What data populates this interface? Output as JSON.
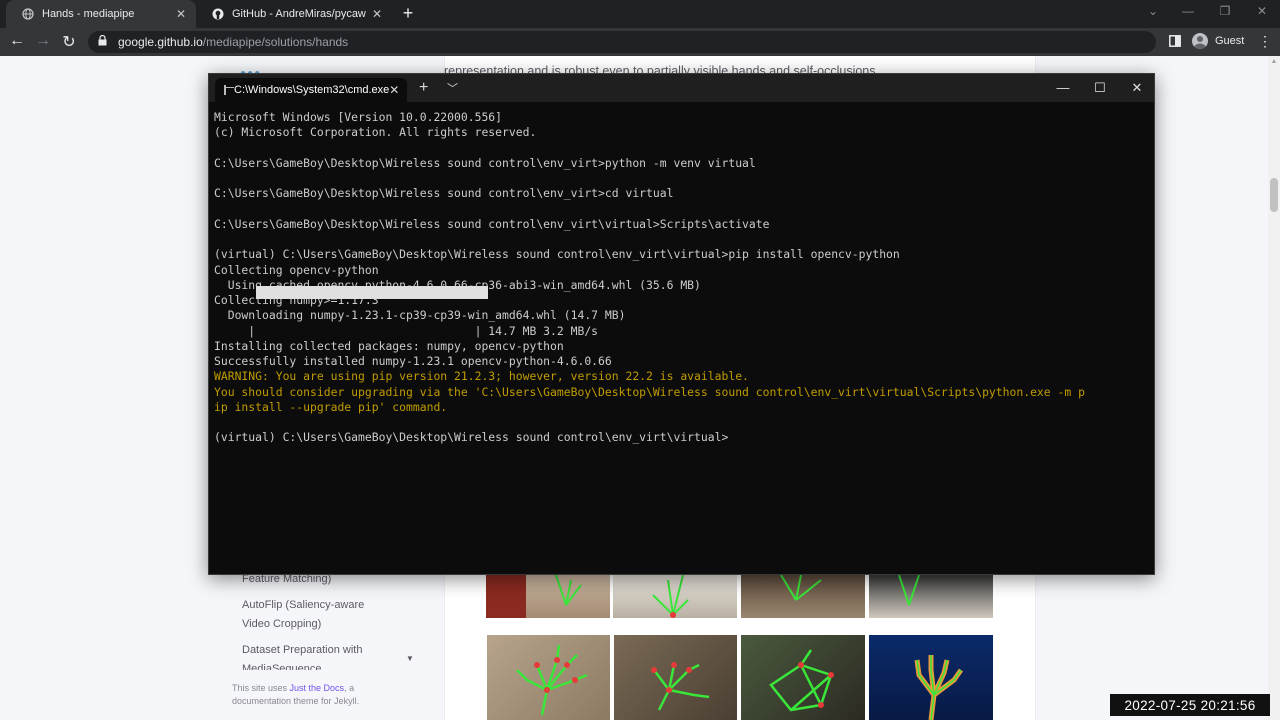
{
  "browser": {
    "tabs": [
      {
        "title": "Hands - mediapipe",
        "active": true
      },
      {
        "title": "GitHub - AndreMiras/pycaw: Pyth",
        "active": false
      }
    ],
    "new_tab_label": "+",
    "address_host": "google.github.io",
    "address_path": "/mediapipe/solutions/hands",
    "profile_label": "Guest"
  },
  "page": {
    "top_text": "representation and is robust even to partially visible hands and self-occlusions.",
    "sidebar_items": [
      "Feature Matching)",
      "AutoFlip (Saliency-aware",
      "Video Cropping)",
      "Dataset Preparation with",
      "MediaSequence"
    ],
    "footer_prefix": "This site uses ",
    "footer_link": "Just the Docs",
    "footer_mid": ", a",
    "footer_line2": "documentation theme for Jekyll."
  },
  "terminal": {
    "tab_title": "C:\\Windows\\System32\\cmd.exe",
    "lines": [
      {
        "text": "Microsoft Windows [Version 10.0.22000.556]",
        "style": "normal"
      },
      {
        "text": "(c) Microsoft Corporation. All rights reserved.",
        "style": "normal"
      },
      {
        "text": "",
        "style": "normal"
      },
      {
        "text": "C:\\Users\\GameBoy\\Desktop\\Wireless sound control\\env_virt>python -m venv virtual",
        "style": "normal"
      },
      {
        "text": "",
        "style": "normal"
      },
      {
        "text": "C:\\Users\\GameBoy\\Desktop\\Wireless sound control\\env_virt>cd virtual",
        "style": "normal"
      },
      {
        "text": "",
        "style": "normal"
      },
      {
        "text": "C:\\Users\\GameBoy\\Desktop\\Wireless sound control\\env_virt\\virtual>Scripts\\activate",
        "style": "normal"
      },
      {
        "text": "",
        "style": "normal"
      },
      {
        "text": "(virtual) C:\\Users\\GameBoy\\Desktop\\Wireless sound control\\env_virt\\virtual>pip install opencv-python",
        "style": "normal"
      },
      {
        "text": "Collecting opencv-python",
        "style": "normal"
      },
      {
        "text": "  Using cached opencv_python-4.6.0.66-cp36-abi3-win_amd64.whl (35.6 MB)",
        "style": "normal"
      },
      {
        "text": "Collecting numpy>=1.17.3",
        "style": "normal"
      },
      {
        "text": "  Downloading numpy-1.23.1-cp39-cp39-win_amd64.whl (14.7 MB)",
        "style": "normal"
      },
      {
        "text": "     |                                | 14.7 MB 3.2 MB/s",
        "style": "normal"
      },
      {
        "text": "Installing collected packages: numpy, opencv-python",
        "style": "normal"
      },
      {
        "text": "Successfully installed numpy-1.23.1 opencv-python-4.6.0.66",
        "style": "normal"
      },
      {
        "text": "WARNING: You are using pip version 21.2.3; however, version 22.2 is available.",
        "style": "warn"
      },
      {
        "text": "You should consider upgrading via the 'C:\\Users\\GameBoy\\Desktop\\Wireless sound control\\env_virt\\virtual\\Scripts\\python.exe -m p",
        "style": "warn"
      },
      {
        "text": "ip install --upgrade pip' command.",
        "style": "warn"
      },
      {
        "text": "",
        "style": "normal"
      },
      {
        "text": "(virtual) C:\\Users\\GameBoy\\Desktop\\Wireless sound control\\env_virt\\virtual>",
        "style": "normal"
      }
    ],
    "download_progress": 1.0,
    "colors": {
      "background": "#0c0c0c",
      "text": "#cccccc",
      "warning": "#c19c00"
    }
  },
  "overlay": {
    "timestamp": "2022-07-25  20:21:56"
  }
}
